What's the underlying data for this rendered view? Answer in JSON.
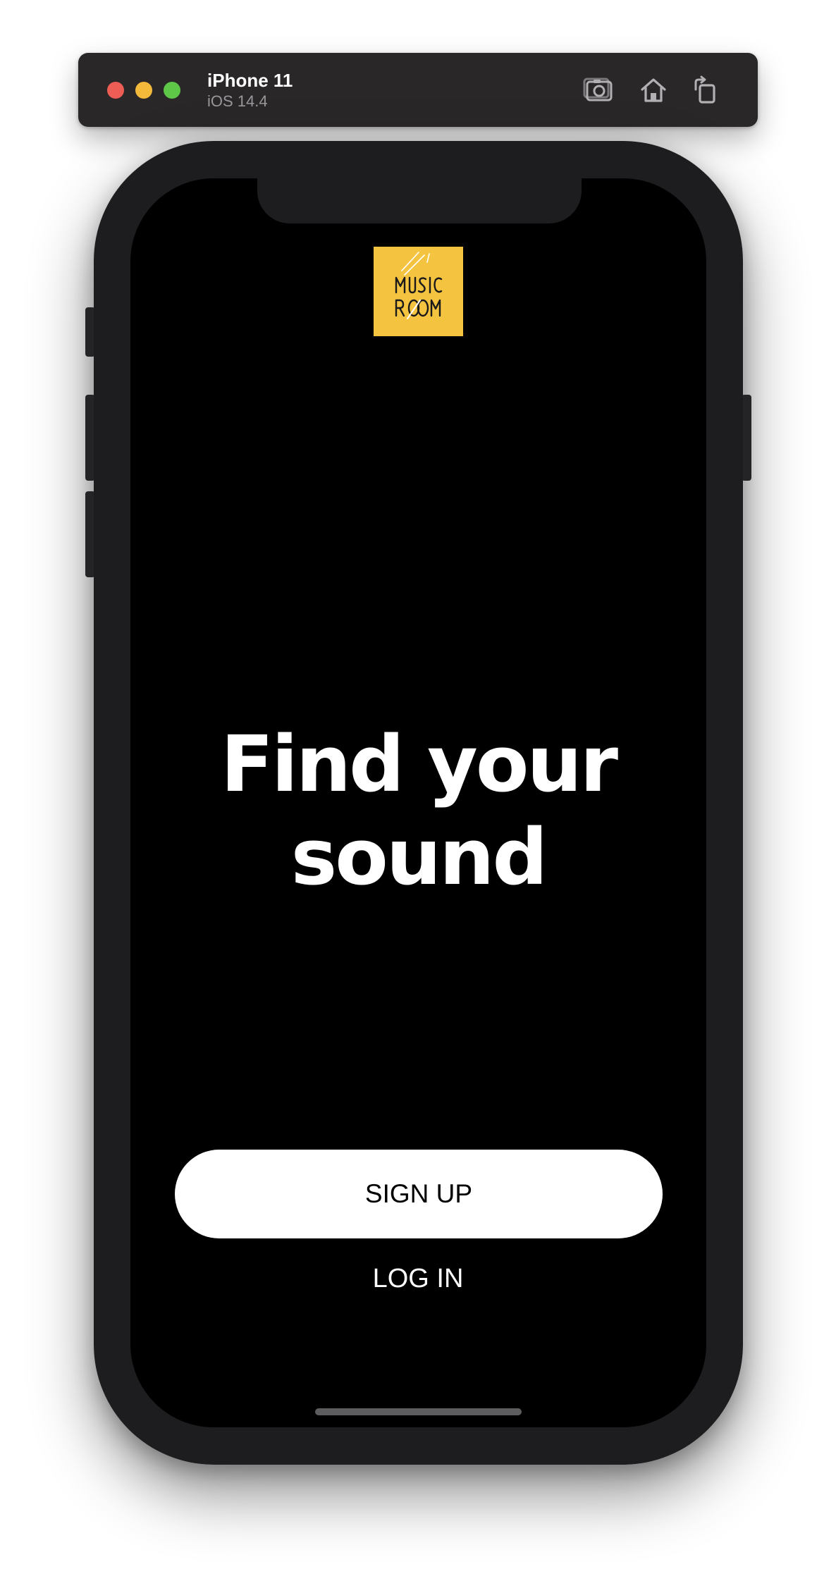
{
  "simulator": {
    "device_name": "iPhone 11",
    "os_version": "iOS 14.4",
    "toolbar_actions": [
      {
        "icon": "camera-icon",
        "action": "screenshot"
      },
      {
        "icon": "home-icon",
        "action": "home"
      },
      {
        "icon": "rotate-icon",
        "action": "rotate"
      }
    ]
  },
  "app": {
    "logo": {
      "brand_text": "MUSIC ROOM",
      "background_color": "#f4c33f"
    },
    "headline": {
      "line1": "Find your",
      "line2": "sound"
    },
    "buttons": {
      "signup_label": "SIGN UP",
      "login_label": "LOG IN"
    }
  },
  "colors": {
    "screen_background": "#000000",
    "primary_button_background": "#ffffff",
    "primary_button_text": "#000000",
    "secondary_button_text": "#ffffff",
    "logo_accent": "#f4c33f"
  }
}
